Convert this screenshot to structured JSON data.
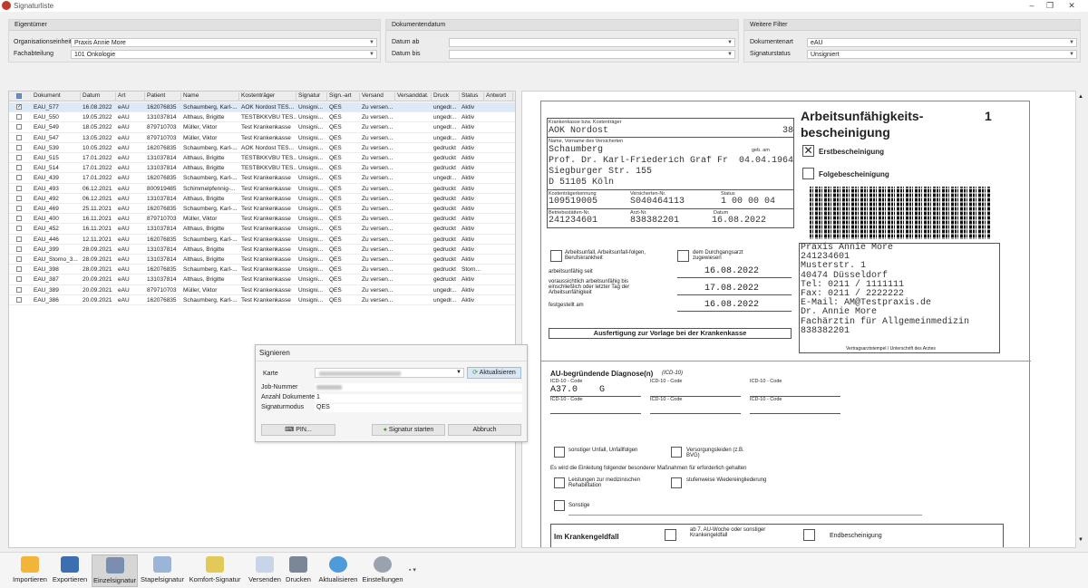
{
  "window": {
    "title": "Signaturliste",
    "minimize": "–",
    "restore": "❐",
    "close": "✕"
  },
  "filters": {
    "eigentuemer": {
      "title": "Eigentümer",
      "org_label": "Organisationseinheit",
      "org_value": "Praxis Annie More",
      "fach_label": "Fachabteilung",
      "fach_value": "101 Onkologie"
    },
    "datum": {
      "title": "Dokumentendatum",
      "ab_label": "Datum ab",
      "ab_value": "",
      "bis_label": "Datum bis",
      "bis_value": ""
    },
    "weitere": {
      "title": "Weitere Filter",
      "art_label": "Dokumentenart",
      "art_value": "eAU",
      "status_label": "Signaturstatus",
      "status_value": "Unsigniert"
    }
  },
  "table": {
    "columns": [
      "Dokument",
      "Datum",
      "Art",
      "Patient",
      "Name",
      "Kostenträger",
      "Signatur",
      "Sign.-art",
      "Versand",
      "Versanddat.",
      "Druck",
      "Status",
      "Antwort"
    ],
    "rows": [
      {
        "checked": "✓",
        "doc": "EAU_577",
        "date": "16.08.2022",
        "art": "eAU",
        "patient": "162076835",
        "name": "Schaumberg, Karl-...",
        "kt": "AOK Nordost TES...",
        "sig": "Unsigni...",
        "sa": "QES",
        "vs": "Zu versen...",
        "vd": "",
        "dr": "ungedr...",
        "st": "Aktiv"
      },
      {
        "checked": "",
        "doc": "EAU_550",
        "date": "19.05.2022",
        "art": "eAU",
        "patient": "131037814",
        "name": "Althaus, Brigitte",
        "kt": "TESTBKKVBU TES...",
        "sig": "Unsigni...",
        "sa": "QES",
        "vs": "Zu versen...",
        "vd": "",
        "dr": "ungedr...",
        "st": "Aktiv"
      },
      {
        "checked": "",
        "doc": "EAU_549",
        "date": "18.05.2022",
        "art": "eAU",
        "patient": "879710703",
        "name": "Müller, Viktor",
        "kt": "Test Krankenkasse",
        "sig": "Unsigni...",
        "sa": "QES",
        "vs": "Zu versen...",
        "vd": "",
        "dr": "ungedr...",
        "st": "Aktiv"
      },
      {
        "checked": "",
        "doc": "EAU_547",
        "date": "13.05.2022",
        "art": "eAU",
        "patient": "879710703",
        "name": "Müller, Viktor",
        "kt": "Test Krankenkasse",
        "sig": "Unsigni...",
        "sa": "QES",
        "vs": "Zu versen...",
        "vd": "",
        "dr": "ungedr...",
        "st": "Aktiv"
      },
      {
        "checked": "",
        "doc": "EAU_539",
        "date": "10.05.2022",
        "art": "eAU",
        "patient": "162076835",
        "name": "Schaumberg, Karl-...",
        "kt": "AOK Nordost TES...",
        "sig": "Unsigni...",
        "sa": "QES",
        "vs": "Zu versen...",
        "vd": "",
        "dr": "gedruckt",
        "st": "Aktiv"
      },
      {
        "checked": "",
        "doc": "EAU_515",
        "date": "17.01.2022",
        "art": "eAU",
        "patient": "131037814",
        "name": "Althaus, Brigitte",
        "kt": "TESTBKKVBU TES...",
        "sig": "Unsigni...",
        "sa": "QES",
        "vs": "Zu versen...",
        "vd": "",
        "dr": "gedruckt",
        "st": "Aktiv"
      },
      {
        "checked": "",
        "doc": "EAU_514",
        "date": "17.01.2022",
        "art": "eAU",
        "patient": "131037814",
        "name": "Althaus, Brigitte",
        "kt": "TESTBKKVBU TES...",
        "sig": "Unsigni...",
        "sa": "QES",
        "vs": "Zu versen...",
        "vd": "",
        "dr": "gedruckt",
        "st": "Aktiv"
      },
      {
        "checked": "",
        "doc": "EAU_439",
        "date": "17.01.2022",
        "art": "eAU",
        "patient": "162076835",
        "name": "Schaumberg, Karl-...",
        "kt": "Test Krankenkasse",
        "sig": "Unsigni...",
        "sa": "QES",
        "vs": "Zu versen...",
        "vd": "",
        "dr": "ungedr...",
        "st": "Aktiv"
      },
      {
        "checked": "",
        "doc": "EAU_493",
        "date": "06.12.2021",
        "art": "eAU",
        "patient": "800919485",
        "name": "Schimmelpfennig-...",
        "kt": "Test Krankenkasse",
        "sig": "Unsigni...",
        "sa": "QES",
        "vs": "Zu versen...",
        "vd": "",
        "dr": "gedruckt",
        "st": "Aktiv"
      },
      {
        "checked": "",
        "doc": "EAU_492",
        "date": "06.12.2021",
        "art": "eAU",
        "patient": "131037814",
        "name": "Althaus, Brigitte",
        "kt": "Test Krankenkasse",
        "sig": "Unsigni...",
        "sa": "QES",
        "vs": "Zu versen...",
        "vd": "",
        "dr": "gedruckt",
        "st": "Aktiv"
      },
      {
        "checked": "",
        "doc": "EAU_469",
        "date": "25.11.2021",
        "art": "eAU",
        "patient": "162076835",
        "name": "Schaumberg, Karl-...",
        "kt": "Test Krankenkasse",
        "sig": "Unsigni...",
        "sa": "QES",
        "vs": "Zu versen...",
        "vd": "",
        "dr": "gedruckt",
        "st": "Aktiv"
      },
      {
        "checked": "",
        "doc": "EAU_400",
        "date": "16.11.2021",
        "art": "eAU",
        "patient": "879710703",
        "name": "Müller, Viktor",
        "kt": "Test Krankenkasse",
        "sig": "Unsigni...",
        "sa": "QES",
        "vs": "Zu versen...",
        "vd": "",
        "dr": "gedruckt",
        "st": "Aktiv"
      },
      {
        "checked": "",
        "doc": "EAU_452",
        "date": "16.11.2021",
        "art": "eAU",
        "patient": "131037814",
        "name": "Althaus, Brigitte",
        "kt": "Test Krankenkasse",
        "sig": "Unsigni...",
        "sa": "QES",
        "vs": "Zu versen...",
        "vd": "",
        "dr": "gedruckt",
        "st": "Aktiv"
      },
      {
        "checked": "",
        "doc": "EAU_446",
        "date": "12.11.2021",
        "art": "eAU",
        "patient": "162076835",
        "name": "Schaumberg, Karl-...",
        "kt": "Test Krankenkasse",
        "sig": "Unsigni...",
        "sa": "QES",
        "vs": "Zu versen...",
        "vd": "",
        "dr": "gedruckt",
        "st": "Aktiv"
      },
      {
        "checked": "",
        "doc": "EAU_399",
        "date": "28.09.2021",
        "art": "eAU",
        "patient": "131037814",
        "name": "Althaus, Brigitte",
        "kt": "Test Krankenkasse",
        "sig": "Unsigni...",
        "sa": "QES",
        "vs": "Zu versen...",
        "vd": "",
        "dr": "gedruckt",
        "st": "Aktiv"
      },
      {
        "checked": "",
        "doc": "EAU_Storno_3...",
        "date": "28.09.2021",
        "art": "eAU",
        "patient": "131037814",
        "name": "Althaus, Brigitte",
        "kt": "Test Krankenkasse",
        "sig": "Unsigni...",
        "sa": "QES",
        "vs": "Zu versen...",
        "vd": "",
        "dr": "gedruckt",
        "st": "Aktiv"
      },
      {
        "checked": "",
        "doc": "EAU_398",
        "date": "28.09.2021",
        "art": "eAU",
        "patient": "162076835",
        "name": "Schaumberg, Karl-...",
        "kt": "Test Krankenkasse",
        "sig": "Unsigni...",
        "sa": "QES",
        "vs": "Zu versen...",
        "vd": "",
        "dr": "gedruckt",
        "st": "Storn..."
      },
      {
        "checked": "",
        "doc": "EAU_387",
        "date": "20.09.2021",
        "art": "eAU",
        "patient": "131037814",
        "name": "Althaus, Brigitte",
        "kt": "Test Krankenkasse",
        "sig": "Unsigni...",
        "sa": "QES",
        "vs": "Zu versen...",
        "vd": "",
        "dr": "gedruckt",
        "st": "Aktiv"
      },
      {
        "checked": "",
        "doc": "EAU_389",
        "date": "20.09.2021",
        "art": "eAU",
        "patient": "879710703",
        "name": "Müller, Viktor",
        "kt": "Test Krankenkasse",
        "sig": "Unsigni...",
        "sa": "QES",
        "vs": "Zu versen...",
        "vd": "",
        "dr": "ungedr...",
        "st": "Aktiv"
      },
      {
        "checked": "",
        "doc": "EAU_386",
        "date": "20.09.2021",
        "art": "eAU",
        "patient": "162076835",
        "name": "Schaumberg, Karl-...",
        "kt": "Test Krankenkasse",
        "sig": "Unsigni...",
        "sa": "QES",
        "vs": "Zu versen...",
        "vd": "",
        "dr": "ungedr...",
        "st": "Aktiv"
      }
    ]
  },
  "dialog": {
    "title": "Signieren",
    "karte_label": "Karte",
    "refresh": "Aktualisieren",
    "job_label": "Job-Nummer",
    "anzahl_label": "Anzahl Dokumente",
    "anzahl_value": "1",
    "modus_label": "Signaturmodus",
    "modus_value": "QES",
    "pin": "PIN...",
    "start": "Signatur starten",
    "abort": "Abbruch"
  },
  "form": {
    "kk_label": "Krankenkasse bzw. Kostenträger",
    "kk_value": "AOK Nordost",
    "kk_num": "38",
    "name_label": "Name, Vorname des Versicherten",
    "geb_label": "geb. am",
    "name1": "Schaumberg",
    "name2": "Prof. Dr. Karl-Friederich Graf Fr",
    "geb": "04.04.1964",
    "street": "Siegburger Str. 155",
    "city": "D 51105 Köln",
    "ktk_label": "Kostenträgerkennung",
    "ktk": "109519005",
    "vnr_label": "Versicherten-Nr.",
    "vnr": "S040464113",
    "status_label": "Status",
    "status": "1 00 00 04",
    "bsnr_label": "Betriebsstätten-Nr.",
    "bsnr": "241234601",
    "lanr_label": "Arzt-Nr.",
    "lanr": "838382201",
    "datum_label": "Datum",
    "datum": "16.08.2022",
    "title1": "Arbeitsunfähigkeits-",
    "title2": "bescheinigung",
    "copy": "1",
    "erst": "Erstbescheinigung",
    "folge": "Folgebescheinigung",
    "unfall": "Arbeitsunfall, Arbeitsunfall-folgen, Berufskrankheit",
    "durchgang": "dem Durchgangsarzt zugewiesen",
    "au_seit_label": "arbeitsunfähig seit",
    "au_seit": "16.08.2022",
    "au_bis_label": "voraussichtlich arbeitsunfähig bis einschließlich oder letzter Tag der Arbeitsunfähigkeit",
    "au_bis": "17.08.2022",
    "fest_label": "festgestellt am",
    "fest": "16.08.2022",
    "stamp": [
      "Praxis Annie More",
      "241234601",
      "Musterstr.  1",
      "40474 Düsseldorf",
      "Tel: 0211 / 1111111",
      "Fax: 0211 / 2222222",
      "E-Mail: AM@Testpraxis.de",
      "Dr. Annie More",
      "Fachärztin für Allgemeinmedizin",
      "838382201"
    ],
    "stamp_caption": "Vertragsarztstempel / Unterschrift des Arztes",
    "ausfertigung": "Ausfertigung zur Vorlage bei der Krankenkasse",
    "diag_title": "AU-begründende Diagnose(n)",
    "diag_sub": "(ICD-10)",
    "icd_label": "ICD-10 - Code",
    "icd1": "A37.0    G",
    "sonst_unfall": "sonstiger Unfall, Unfallfolgen",
    "versorg": "Versorgungsleiden (z.B. BVG)",
    "einleitung": "Es wird die Einleitung folgender besonderer Maßnahmen für erforderlich gehalten",
    "reha": "Leistungen zur medizinischen Rehabilitation",
    "stufen": "stufenweise Wiedereingliederung",
    "sonstige": "Sonstige",
    "kgeld": "Im Krankengeldfall",
    "ab7": "ab 7. AU-Woche oder sonstiger Krankengeldfall",
    "end": "Endbescheinigung"
  },
  "toolbar": [
    "Importieren",
    "Exportieren",
    "Einzelsignatur",
    "Stapelsignatur",
    "Komfort-Signatur",
    "Versenden",
    "Drucken",
    "Aktualisieren",
    "Einstellungen"
  ]
}
